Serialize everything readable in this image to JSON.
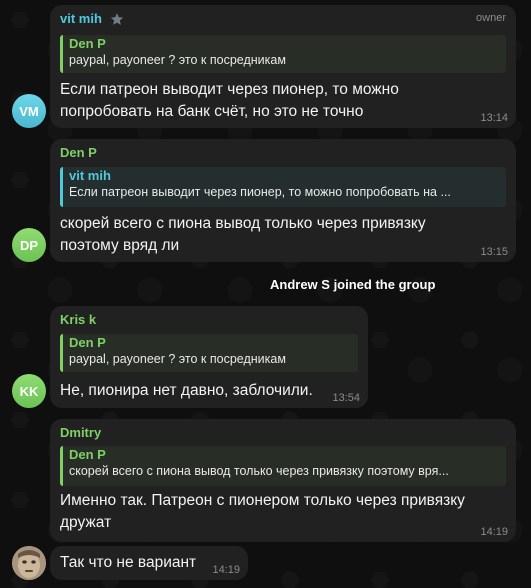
{
  "messages": [
    {
      "sender": "vit mih",
      "badge": "owner",
      "reply_to": {
        "name": "Den P",
        "text": "paypal, payoneer ? это к посредникам"
      },
      "text": "Если патреон выводит через пионер, то можно попробовать на банк счёт, но это не точно",
      "time": "13:14",
      "avatar": "VM"
    },
    {
      "sender": "Den P",
      "reply_to": {
        "name": "vit mih",
        "text": "Если патреон выводит через пионер, то можно попробовать на ..."
      },
      "text": "скорей всего с пиона вывод только через привязку поэтому вряд ли",
      "time": "13:15",
      "avatar": "DP"
    },
    {
      "sender": "Kris k",
      "reply_to": {
        "name": "Den P",
        "text": "paypal, payoneer ? это к посредникам"
      },
      "text": "Не, пионира нет давно, заблочили.",
      "time": "13:54",
      "avatar": "KK"
    },
    {
      "sender": "Dmitry",
      "reply_to": {
        "name": "Den P",
        "text": "скорей всего с пиона вывод только через привязку поэтому вря..."
      },
      "text": "Именно так. Патреон с пионером только через привязку дружат",
      "time": "14:19"
    },
    {
      "text": "Так что не вариант",
      "time": "14:19"
    }
  ],
  "service_message": "Andrew S joined the group",
  "colors": {
    "vit_mih": "#4fc9dc",
    "den_p": "#7ed067",
    "kris_k": "#7ed067",
    "dmitry": "#7ed067",
    "bubble": "#212121",
    "background": "#0f0f0f"
  }
}
